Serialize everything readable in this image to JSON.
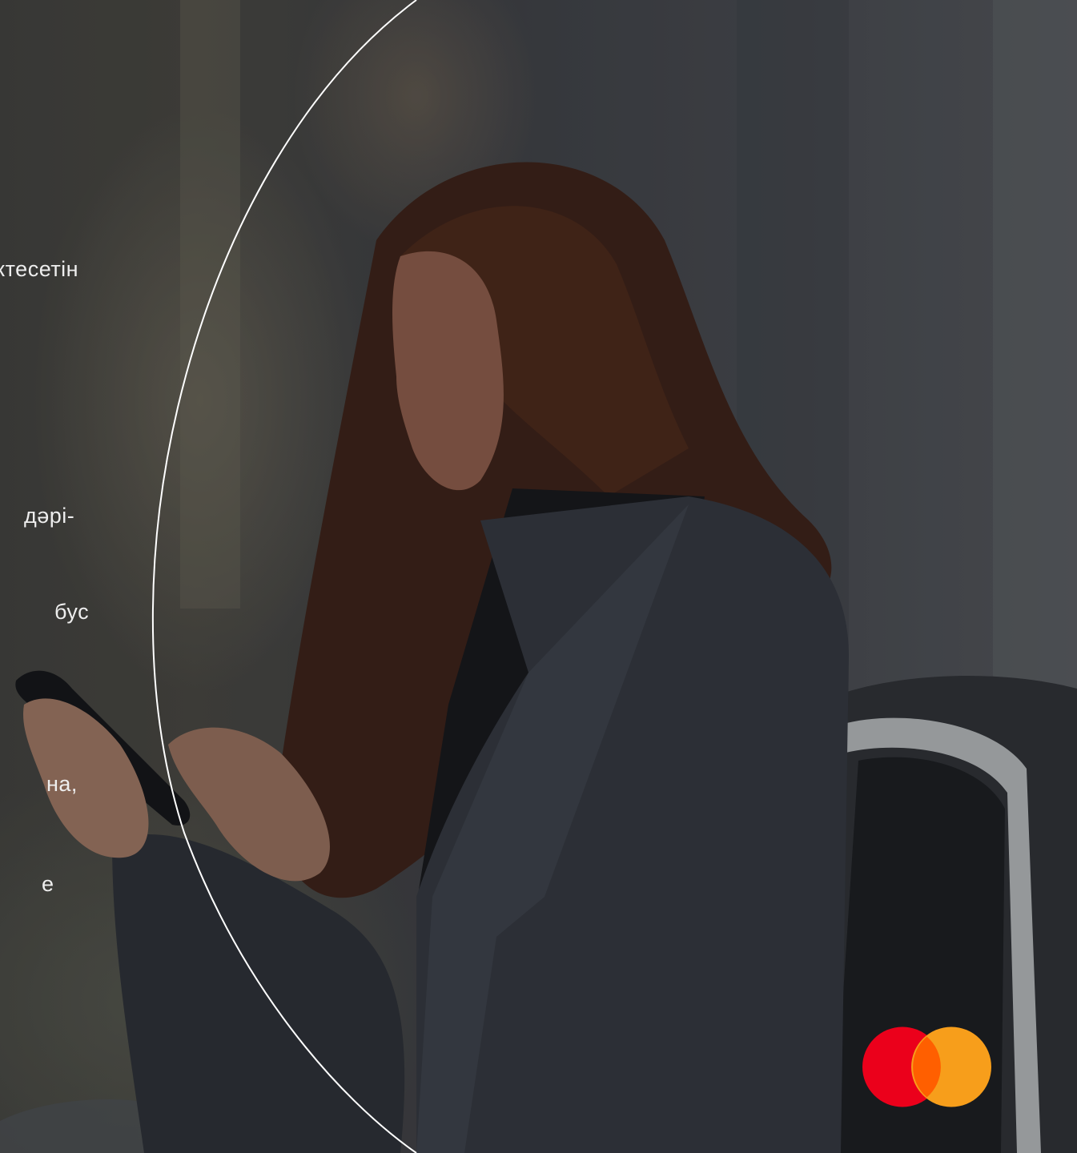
{
  "slide": {
    "text_fragments": [
      "ктесетін",
      "дәрі-",
      "бус",
      "на,",
      "е"
    ],
    "colors": {
      "logo_red": "#EB001B",
      "logo_orange": "#F79E1B",
      "logo_overlap": "#FF5F00",
      "arc_stroke": "#ffffff",
      "text": "#eeeeee"
    }
  },
  "logo": {
    "brand_icon": "mastercard-logo"
  }
}
